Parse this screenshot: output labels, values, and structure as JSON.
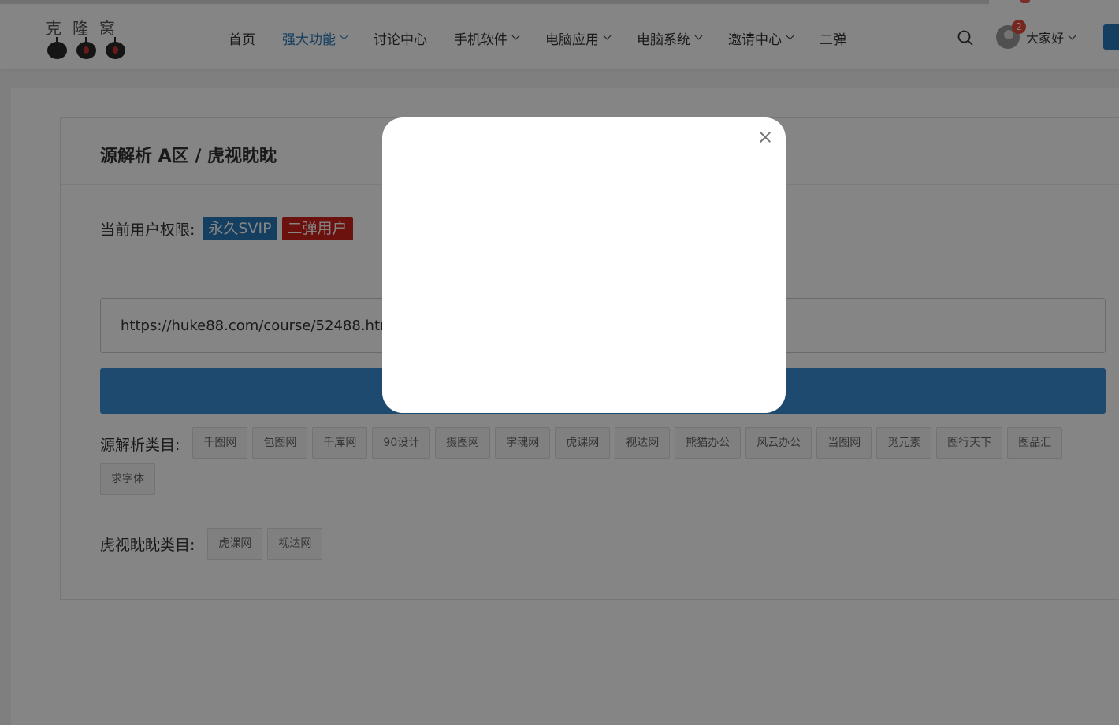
{
  "logo": {
    "chars": [
      "克",
      "隆",
      "窝"
    ]
  },
  "nav": {
    "items": [
      {
        "label": "首页",
        "dropdown": false,
        "active": false
      },
      {
        "label": "强大功能",
        "dropdown": true,
        "active": true
      },
      {
        "label": "讨论中心",
        "dropdown": false,
        "active": false
      },
      {
        "label": "手机软件",
        "dropdown": true,
        "active": false
      },
      {
        "label": "电脑应用",
        "dropdown": true,
        "active": false
      },
      {
        "label": "电脑系统",
        "dropdown": true,
        "active": false
      },
      {
        "label": "邀请中心",
        "dropdown": true,
        "active": false
      },
      {
        "label": "二弹",
        "dropdown": false,
        "active": false
      }
    ]
  },
  "user": {
    "name": "大家好",
    "notification_count": "2"
  },
  "page": {
    "title": "源解析 A区 / 虎视眈眈",
    "permission_label": "当前用户权限:",
    "permission_tags": [
      "永久SVIP",
      "二弹用户"
    ]
  },
  "url_input": {
    "value": "https://huke88.com/course/52488.html"
  },
  "categories": {
    "source_label": "源解析类目:",
    "source_items": [
      "千图网",
      "包图网",
      "千库网",
      "90设计",
      "摄图网",
      "字魂网",
      "虎课网",
      "视达网",
      "熊猫办公",
      "风云办公",
      "当图网",
      "觅元素",
      "图行天下",
      "图品汇",
      "求字体"
    ],
    "hushi_label": "虎视眈眈类目:",
    "hushi_items": [
      "虎课网",
      "视达网"
    ]
  },
  "colors": {
    "accent": "#2a7ab8",
    "danger": "#d0241b",
    "button": "#3a8fd6"
  }
}
